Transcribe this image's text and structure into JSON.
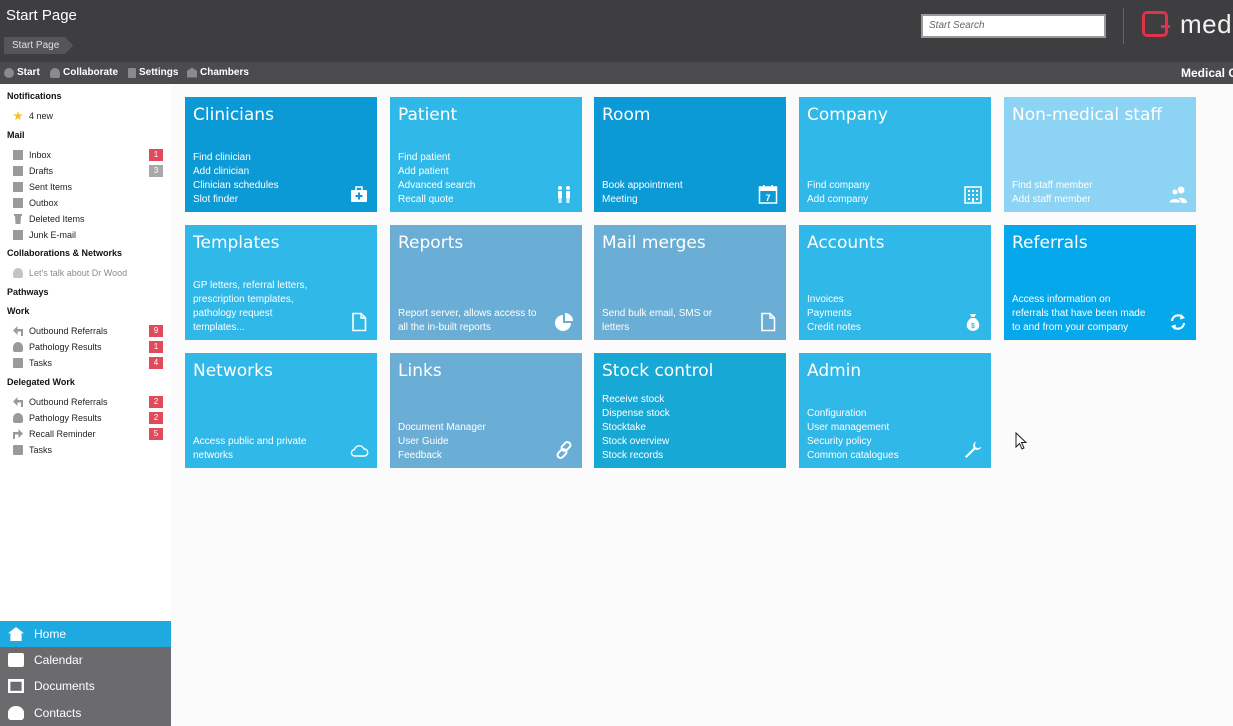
{
  "header": {
    "title": "Start Page",
    "breadcrumb": "Start Page",
    "search_placeholder": "Start Search",
    "logo_text": "med"
  },
  "toolbar": {
    "items": [
      "Start",
      "Collaborate",
      "Settings",
      "Chambers"
    ],
    "right_label": "Medical C"
  },
  "sidebar": {
    "notifications": {
      "heading": "Notifications",
      "item": "4 new"
    },
    "mail": {
      "heading": "Mail",
      "items": [
        {
          "label": "Inbox",
          "count": "1",
          "badge": "red"
        },
        {
          "label": "Drafts",
          "count": "3",
          "badge": "grey"
        },
        {
          "label": "Sent Items",
          "count": ""
        },
        {
          "label": "Outbox",
          "count": ""
        },
        {
          "label": "Deleted Items",
          "count": ""
        },
        {
          "label": "Junk E-mail",
          "count": ""
        }
      ]
    },
    "collaborations": {
      "heading": "Collaborations & Networks",
      "item": "Let's talk about Dr Wood"
    },
    "pathways": {
      "heading": "Pathways"
    },
    "work": {
      "heading": "Work",
      "items": [
        {
          "label": "Outbound Referrals",
          "count": "9"
        },
        {
          "label": "Pathology Results",
          "count": "1"
        },
        {
          "label": "Tasks",
          "count": "4"
        }
      ]
    },
    "delegated": {
      "heading": "Delegated Work",
      "items": [
        {
          "label": "Outbound Referrals",
          "count": "2"
        },
        {
          "label": "Pathology Results",
          "count": "2"
        },
        {
          "label": "Recall Reminder",
          "count": "5"
        },
        {
          "label": "Tasks",
          "count": ""
        }
      ]
    }
  },
  "bottom_nav": [
    "Home",
    "Calendar",
    "Documents",
    "Contacts"
  ],
  "tiles": [
    {
      "title": "Clinicians",
      "lines": [
        "Find clinician",
        "Add clinician",
        "Clinician schedules",
        "Slot finder"
      ],
      "icon": "medical-bag-icon",
      "color": "#0b9ad6"
    },
    {
      "title": "Patient",
      "lines": [
        "Find patient",
        "Add patient",
        "Advanced search",
        "Recall quote"
      ],
      "icon": "people-icon",
      "color": "#2fb8e8"
    },
    {
      "title": "Room",
      "lines": [
        "Book appointment",
        "Meeting"
      ],
      "icon": "calendar-icon",
      "color": "#0b9ad6"
    },
    {
      "title": "Company",
      "lines": [
        "Find company",
        "Add company"
      ],
      "icon": "building-icon",
      "color": "#2fb8e8"
    },
    {
      "title": "Non-medical staff",
      "lines": [
        "Find staff member",
        "Add staff member"
      ],
      "icon": "users-icon",
      "color": "#8dd3f3"
    },
    {
      "title": "Templates",
      "lines": [
        "GP letters, referral letters,",
        "prescription templates,",
        "pathology request",
        "templates..."
      ],
      "icon": "document-icon",
      "color": "#2fb8e8"
    },
    {
      "title": "Reports",
      "lines": [
        "Report server, allows access to",
        "all the in-built reports"
      ],
      "icon": "pie-chart-icon",
      "color": "#6aaed6"
    },
    {
      "title": "Mail merges",
      "lines": [
        "Send bulk email, SMS or",
        "letters"
      ],
      "icon": "document-icon",
      "color": "#6aaed6"
    },
    {
      "title": "Accounts",
      "lines": [
        "Invoices",
        "Payments",
        "Credit notes"
      ],
      "icon": "money-bag-icon",
      "color": "#2fb8e8"
    },
    {
      "title": "Referrals",
      "lines": [
        "Access information on",
        "referrals that have been made",
        "to and from your company"
      ],
      "icon": "refresh-icon",
      "color": "#05a8ea"
    },
    {
      "title": "Networks",
      "lines": [
        "Access public and private",
        "networks"
      ],
      "icon": "cloud-icon",
      "color": "#2fb8e8"
    },
    {
      "title": "Links",
      "lines": [
        "Document Manager",
        "User Guide",
        "Feedback"
      ],
      "icon": "link-icon",
      "color": "#6aaed6"
    },
    {
      "title": "Stock control",
      "lines": [
        "Receive stock",
        "Dispense stock",
        "Stocktake",
        "Stock overview",
        "Stock records"
      ],
      "icon": "",
      "color": "#18a8d6"
    },
    {
      "title": "Admin",
      "lines": [
        "Configuration",
        "User management",
        "Security policy",
        "Common catalogues"
      ],
      "icon": "wrench-icon",
      "color": "#2fb8e8"
    }
  ]
}
